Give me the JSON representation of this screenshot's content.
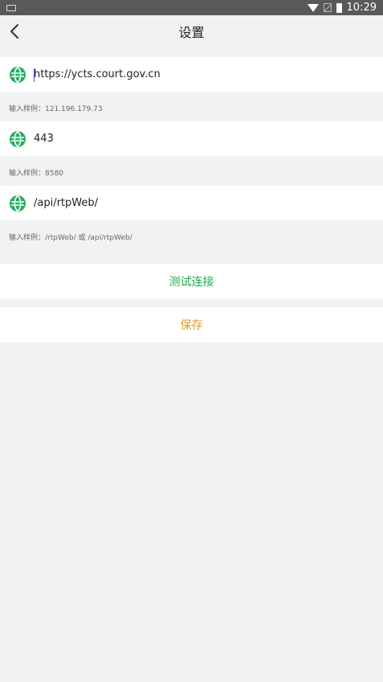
{
  "status_bar": {
    "time": "10:29"
  },
  "header": {
    "title": "设置"
  },
  "fields": [
    {
      "value": "https://ycts.court.gov.cn",
      "hint": "输入样例：121.196.179.73"
    },
    {
      "value": "443",
      "hint": "输入样例：8580"
    },
    {
      "value": "/api/rtpWeb/",
      "hint": "输入样例：/rtpWeb/ 或 /api/rtpWeb/"
    }
  ],
  "actions": {
    "test_label": "测试连接",
    "save_label": "保存"
  },
  "colors": {
    "accent_green": "#1aad48",
    "accent_orange": "#e39b17",
    "background": "#f2f2f2",
    "status_bar": "#595959"
  },
  "icons": {
    "field_icon": "globe-icon",
    "back": "chevron-left-icon"
  }
}
